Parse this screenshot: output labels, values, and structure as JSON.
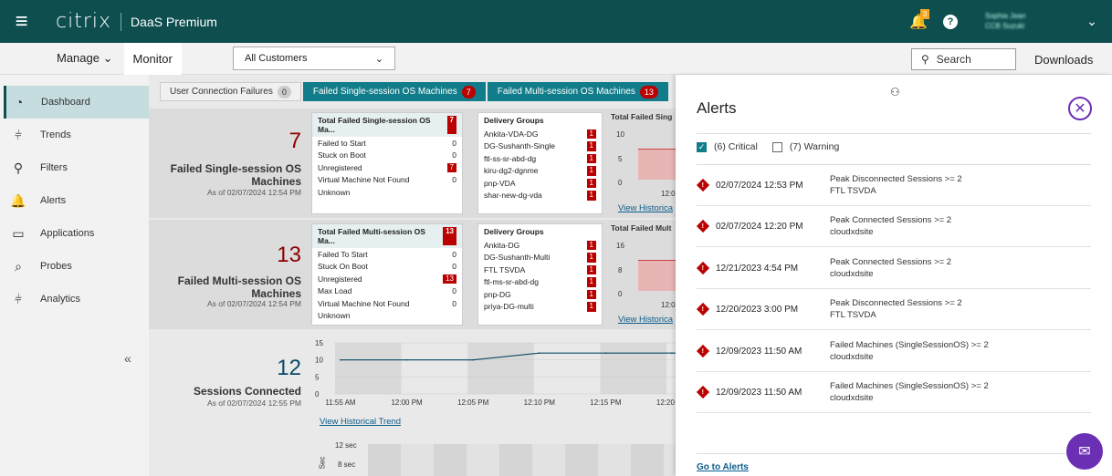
{
  "topbar": {
    "logo": "citrix",
    "product": "DaaS Premium",
    "notif_count": "3",
    "help": "?",
    "user_name": "Sophia Jean",
    "user_sub": "CCB Suzuki",
    "caret": "⌄"
  },
  "nav": {
    "manage": "Manage",
    "monitor": "Monitor",
    "customer_select": "All Customers",
    "search_placeholder": "Search",
    "downloads": "Downloads"
  },
  "sidebar": {
    "items": [
      {
        "label": "Dashboard",
        "icon": "dashboard-icon",
        "glyph": "◔"
      },
      {
        "label": "Trends",
        "icon": "trends-icon",
        "glyph": "⫩"
      },
      {
        "label": "Filters",
        "icon": "filters-icon",
        "glyph": "⚲"
      },
      {
        "label": "Alerts",
        "icon": "bell-icon",
        "glyph": "🔔"
      },
      {
        "label": "Applications",
        "icon": "applications-icon",
        "glyph": "▭"
      },
      {
        "label": "Probes",
        "icon": "probes-icon",
        "glyph": "⌕"
      },
      {
        "label": "Analytics",
        "icon": "analytics-icon",
        "glyph": "⫩"
      }
    ],
    "collapse": "«"
  },
  "tabs": [
    {
      "label": "User Connection Failures",
      "count": "0"
    },
    {
      "label": "Failed Single-session OS Machines",
      "count": "7"
    },
    {
      "label": "Failed Multi-session OS Machines",
      "count": "13"
    }
  ],
  "single": {
    "count": "7",
    "title1": "Failed Single-session OS",
    "title2": "Machines",
    "asof": "As of 02/07/2024 12:54 PM",
    "box_title": "Total Failed Single-session OS Ma...",
    "box_count": "7",
    "rows": [
      {
        "label": "Failed to Start",
        "value": "0"
      },
      {
        "label": "Stuck on Boot",
        "value": "0"
      },
      {
        "label": "Unregistered",
        "value": "7"
      },
      {
        "label": "Virtual Machine Not Found",
        "value": "0"
      },
      {
        "label": "Unknown",
        "value": ""
      }
    ],
    "dg_title": "Delivery Groups",
    "groups": [
      "Ankita-VDA-DG",
      "DG-Sushanth-Single",
      "ftl-ss-sr-abd-dg",
      "kiru-dg2-dgnme",
      "pnp-VDA",
      "shar-new-dg-vda"
    ],
    "group_counts": [
      "1",
      "1",
      "1",
      "1",
      "1",
      "1"
    ],
    "mini_title": "Total Failed Sing",
    "mini_ticks": [
      "10",
      "5",
      "0"
    ],
    "mini_time": "12:0",
    "link": "View Historica"
  },
  "multi": {
    "count": "13",
    "title1": "Failed Multi-session OS",
    "title2": "Machines",
    "asof": "As of 02/07/2024 12:54 PM",
    "box_title": "Total Failed Multi-session OS Ma...",
    "box_count": "13",
    "rows": [
      {
        "label": "Failed To Start",
        "value": "0"
      },
      {
        "label": "Stuck On Boot",
        "value": "0"
      },
      {
        "label": "Unregistered",
        "value": "13"
      },
      {
        "label": "Max Load",
        "value": "0"
      },
      {
        "label": "Virtual Machine Not Found",
        "value": "0"
      },
      {
        "label": "Unknown",
        "value": ""
      }
    ],
    "dg_title": "Delivery Groups",
    "groups": [
      "Ankita-DG",
      "DG-Sushanth-Multi",
      "FTL TSVDA",
      "ftl-ms-sr-abd-dg",
      "pnp-DG",
      "priya-DG-multi"
    ],
    "group_counts": [
      "1",
      "1",
      "1",
      "1",
      "1",
      "1"
    ],
    "mini_title": "Total Failed Mult",
    "mini_ticks": [
      "16",
      "8",
      "0"
    ],
    "mini_time": "12:0",
    "link": "View Historica"
  },
  "sessions": {
    "count": "12",
    "title": "Sessions Connected",
    "asof": "As of 02/07/2024 12:55 PM",
    "link": "View Historical Trend"
  },
  "chart_data": {
    "type": "line",
    "x": [
      "11:55 AM",
      "12:00 PM",
      "12:05 PM",
      "12:10 PM",
      "12:15 PM",
      "12:20 PM"
    ],
    "series": [
      {
        "values": [
          10,
          10,
          10,
          12,
          12,
          12
        ]
      }
    ],
    "yticks": [
      "15",
      "10",
      "5",
      "0"
    ],
    "ylim": [
      0,
      15
    ]
  },
  "lower_chart": {
    "ytick1": "12 sec",
    "ytick2": "8 sec",
    "ylabel": "Sec"
  },
  "alerts": {
    "title": "Alerts",
    "critical_label": "(6) Critical",
    "warning_label": "(7) Warning",
    "items": [
      {
        "date": "02/07/2024 12:53 PM",
        "msg": "Peak Disconnected Sessions >= 2",
        "target": "FTL TSVDA"
      },
      {
        "date": "02/07/2024 12:20 PM",
        "msg": "Peak Connected Sessions >= 2",
        "target": "cloudxdsite"
      },
      {
        "date": "12/21/2023 4:54 PM",
        "msg": "Peak Connected Sessions >= 2",
        "target": "cloudxdsite"
      },
      {
        "date": "12/20/2023 3:00 PM",
        "msg": "Peak Disconnected Sessions >= 2",
        "target": "FTL TSVDA"
      },
      {
        "date": "12/09/2023 11:50 AM",
        "msg": "Failed Machines (SingleSessionOS) >= 2",
        "target": "cloudxdsite"
      },
      {
        "date": "12/09/2023 11:50 AM",
        "msg": "Failed Machines (SingleSessionOS) >= 2",
        "target": "cloudxdsite"
      }
    ],
    "goto": "Go to Alerts"
  },
  "colors": {
    "brand": "#0e4e4f",
    "accent": "#127d8a",
    "critical": "#b00000",
    "purple": "#6b2fb3"
  }
}
